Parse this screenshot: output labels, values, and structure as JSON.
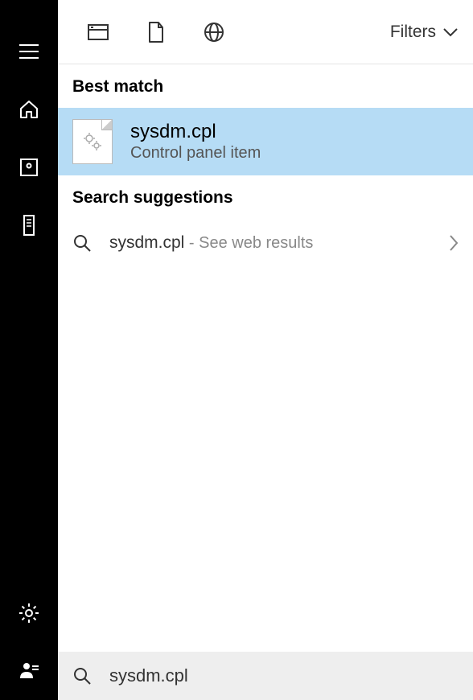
{
  "sidebar": {
    "items": [
      "hamburger",
      "home",
      "app",
      "device"
    ],
    "bottom": [
      "settings",
      "user"
    ]
  },
  "topbar": {
    "filters_label": "Filters"
  },
  "sections": {
    "best_match": "Best match",
    "suggestions": "Search suggestions"
  },
  "best_match": {
    "title": "sysdm.cpl",
    "subtitle": "Control panel item"
  },
  "suggestions": [
    {
      "query": "sysdm.cpl",
      "suffix": " - See web results"
    }
  ],
  "search": {
    "value": "sysdm.cpl"
  }
}
